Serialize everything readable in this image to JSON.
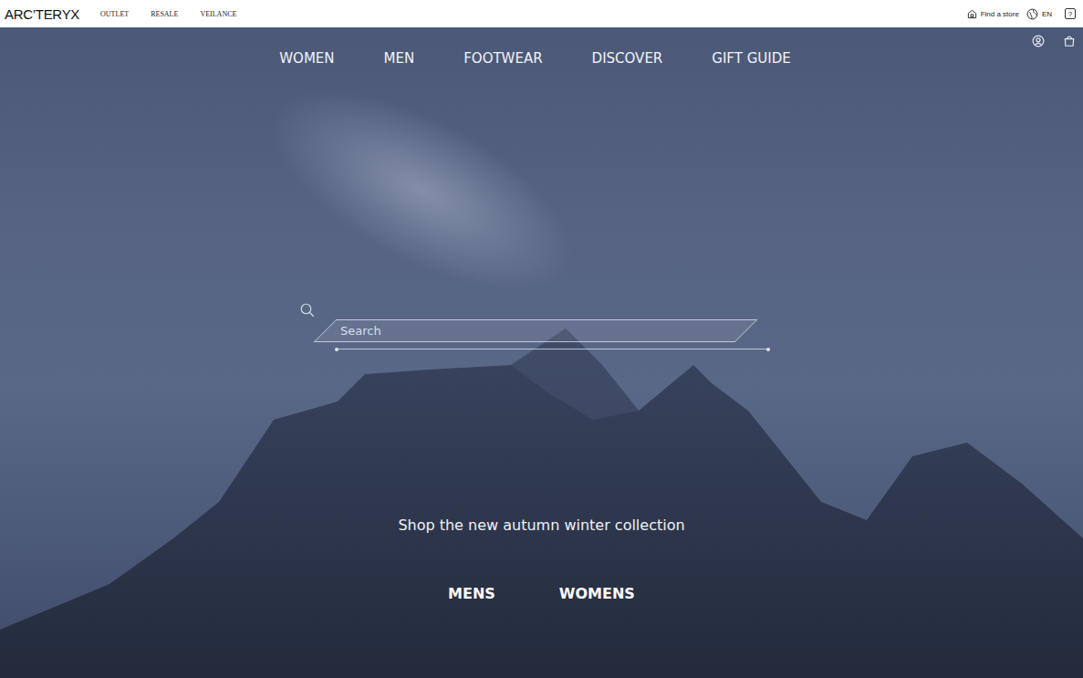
{
  "brand": {
    "logo": "ARC’TERYX"
  },
  "top_links": [
    "OUTLET",
    "RESALE",
    "VEILANCE"
  ],
  "utility": {
    "store": "Find a store",
    "language": "EN",
    "help": "?"
  },
  "nav": [
    "WOMEN",
    "MEN",
    "FOOTWEAR",
    "DISCOVER",
    "GIFT GUIDE"
  ],
  "search": {
    "placeholder": "Search"
  },
  "hero": {
    "caption": "Shop the new autumn winter collection",
    "links": [
      "MENS",
      "WOMENS"
    ]
  }
}
